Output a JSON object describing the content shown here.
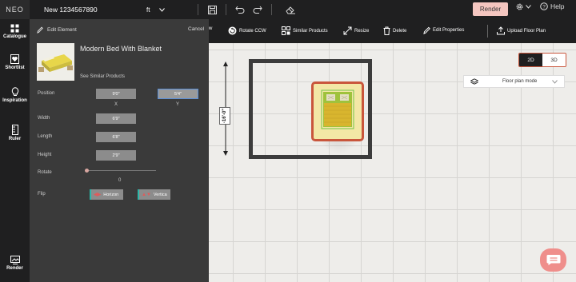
{
  "app": {
    "logo": "NEO",
    "project_name": "New 1234567890",
    "unit": "ft"
  },
  "topbar": {
    "render_label": "Render",
    "help_label": "Help"
  },
  "rail": {
    "items": [
      {
        "label": "Catalogue",
        "icon": "grid-icon"
      },
      {
        "label": "Shortlist",
        "icon": "heart-icon"
      },
      {
        "label": "Inspiration",
        "icon": "bulb-icon"
      },
      {
        "label": "Ruler",
        "icon": "ruler-icon"
      },
      {
        "label": "Render",
        "icon": "render-icon"
      }
    ]
  },
  "panel": {
    "title": "Edit Element",
    "cancel": "Cancel",
    "product_name": "Modern Bed With Blanket",
    "similar_link": "See Similar Products",
    "position_label": "Position",
    "position_x": "9'0\"",
    "position_y": "5'4\"",
    "axis_x": "X",
    "axis_y": "Y",
    "width_label": "Width",
    "width_value": "6'9\"",
    "length_label": "Length",
    "length_value": "6'8\"",
    "height_label": "Height",
    "height_value": "2'9\"",
    "rotate_label": "Rotate",
    "rotate_value": "0",
    "flip_label": "Flip",
    "flip_h": "Horizon",
    "flip_v": "Vertica"
  },
  "toolbar": {
    "rotate_cw": "w",
    "rotate_ccw": "Rotate CCW",
    "similar": "Similar Products",
    "resize": "Resize",
    "delete": "Delete",
    "edit_props": "Edit Properties",
    "upload": "Upload Floor Plan"
  },
  "canvas": {
    "dimension_label": "-16'-0\"",
    "view_2d": "2D",
    "view_3d": "3D",
    "mode": "Floor plan mode"
  },
  "colors": {
    "accent": "#f4c6c0",
    "selection": "#c9563c",
    "chat": "#ef8e8b"
  }
}
